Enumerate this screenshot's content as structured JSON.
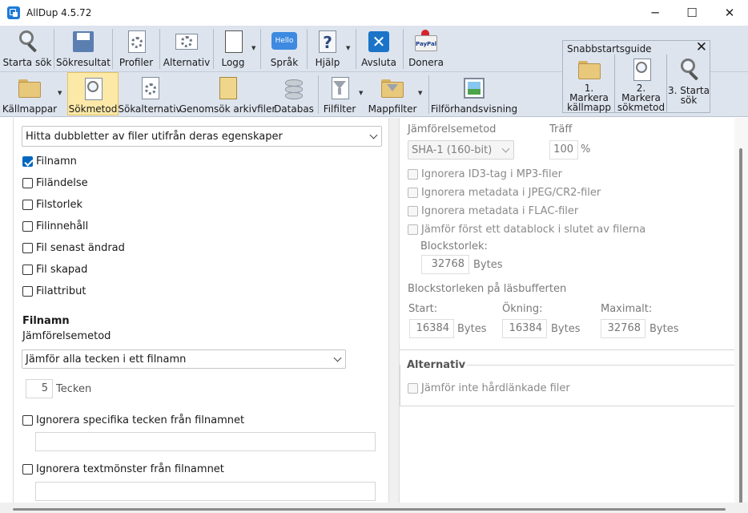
{
  "window": {
    "title": "AllDup 4.5.72",
    "minimize": "─",
    "maximize": "☐",
    "close": "✕"
  },
  "toolbar1": {
    "start_search": "Starta sök",
    "search_results": "Sökresultat",
    "profiles": "Profiler",
    "options": "Alternativ",
    "log": "Logg",
    "language": "Språk",
    "language_icon_text": "Hello",
    "help": "Hjälp",
    "exit": "Avsluta",
    "donate": "Donera",
    "paypal_text": "PayPal"
  },
  "toolbar2": {
    "source_folders": "Källmappar",
    "search_method": "Sökmetod",
    "search_options": "Sökalternativ",
    "scan_archives": "Genomsök arkivfiler",
    "database": "Databas",
    "file_filter": "Filfilter",
    "folder_filter": "Mappfilter",
    "file_preview": "Filförhandsvisning"
  },
  "quickstart": {
    "title": "Snabbstartsguide",
    "close": "✕",
    "step1_line1": "1. Markera",
    "step1_line2": "källmapp",
    "step2_line1": "2. Markera",
    "step2_line2": "sökmetod",
    "step3_line1": "3. Starta",
    "step3_line2": "sök"
  },
  "left": {
    "mode_select": "Hitta dubbletter av filer utifrån deras egenskaper",
    "criteria": [
      {
        "label": "Filnamn",
        "checked": true
      },
      {
        "label": "Filändelse",
        "checked": false
      },
      {
        "label": "Filstorlek",
        "checked": false
      },
      {
        "label": "Filinnehåll",
        "checked": false
      },
      {
        "label": "Fil senast ändrad",
        "checked": false
      },
      {
        "label": "Fil skapad",
        "checked": false
      },
      {
        "label": "Filattribut",
        "checked": false
      }
    ],
    "filename_heading": "Filnamn",
    "compare_method_label": "Jämförelsemetod",
    "compare_method_value": "Jämför alla tecken i ett filnamn",
    "chars_value": "5",
    "chars_unit": "Tecken",
    "ignore_chars_label": "Ignorera specifika tecken från filnamnet",
    "ignore_patterns_label": "Ignorera textmönster från filnamnet"
  },
  "right": {
    "compare_method_label": "Jämförelsemetod",
    "compare_method_value": "SHA-1 (160-bit)",
    "match_label": "Träff",
    "match_value": "100",
    "match_unit": "%",
    "ignore_id3": "Ignorera ID3-tag i MP3-filer",
    "ignore_jpeg_meta": "Ignorera metadata i JPEG/CR2-filer",
    "ignore_flac_meta": "Ignorera metadata i FLAC-filer",
    "compare_end_block": "Jämför först ett datablock i slutet av filerna",
    "block_size_label": "Blockstorlek:",
    "block_size_value": "32768",
    "block_size_unit": "Bytes",
    "buffer_heading": "Blockstorleken på läsbufferten",
    "start_label": "Start:",
    "start_value": "16384",
    "start_unit": "Bytes",
    "increment_label": "Ökning:",
    "increment_value": "16384",
    "increment_unit": "Bytes",
    "max_label": "Maximalt:",
    "max_value": "32768",
    "max_unit": "Bytes",
    "alt_heading": "Alternativ",
    "hardlink_label": "Jämför inte hårdlänkade filer"
  }
}
